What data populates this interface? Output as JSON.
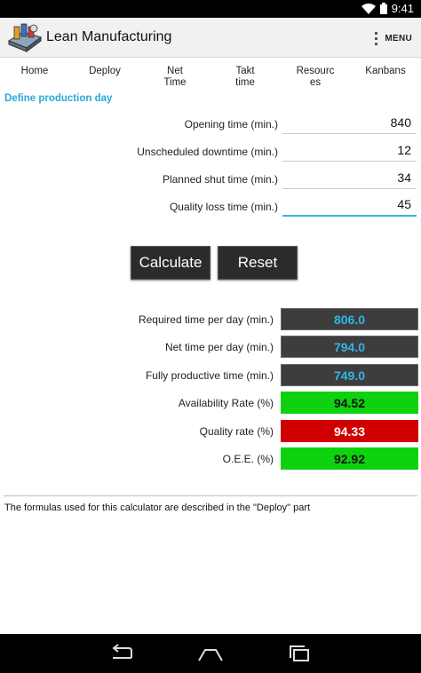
{
  "status_bar": {
    "time": "9:41"
  },
  "app": {
    "title": "Lean Manufacturing",
    "menu_label": "MENU"
  },
  "tabs": [
    {
      "label": "Home"
    },
    {
      "label": "Deploy"
    },
    {
      "label": "Net\nTime"
    },
    {
      "label": "Takt\ntime"
    },
    {
      "label": "Resourc\nes"
    },
    {
      "label": "Kanbans"
    }
  ],
  "section_title": "Define production day",
  "inputs": [
    {
      "label": "Opening time (min.)",
      "value": "840"
    },
    {
      "label": "Unscheduled downtime (min.)",
      "value": "12"
    },
    {
      "label": "Planned shut time (min.)",
      "value": "34"
    },
    {
      "label": "Quality loss time (min.)",
      "value": "45"
    }
  ],
  "buttons": {
    "calculate": "Calculate",
    "reset": "Reset"
  },
  "outputs": [
    {
      "label": "Required time per day (min.)",
      "value": "806.0",
      "style": "dark"
    },
    {
      "label": "Net time per day (min.)",
      "value": "794.0",
      "style": "dark"
    },
    {
      "label": "Fully productive time (min.)",
      "value": "749.0",
      "style": "dark"
    },
    {
      "label": "Availability Rate (%)",
      "value": "94.52",
      "style": "green"
    },
    {
      "label": "Quality rate (%)",
      "value": "94.33",
      "style": "red"
    },
    {
      "label": "O.E.E. (%)",
      "value": "92.92",
      "style": "green"
    }
  ],
  "footer_note": "The formulas used for this calculator are described in the \"Deploy\" part",
  "colors": {
    "accent": "#33b5e5",
    "good": "#0fd20f",
    "bad": "#d10000"
  }
}
